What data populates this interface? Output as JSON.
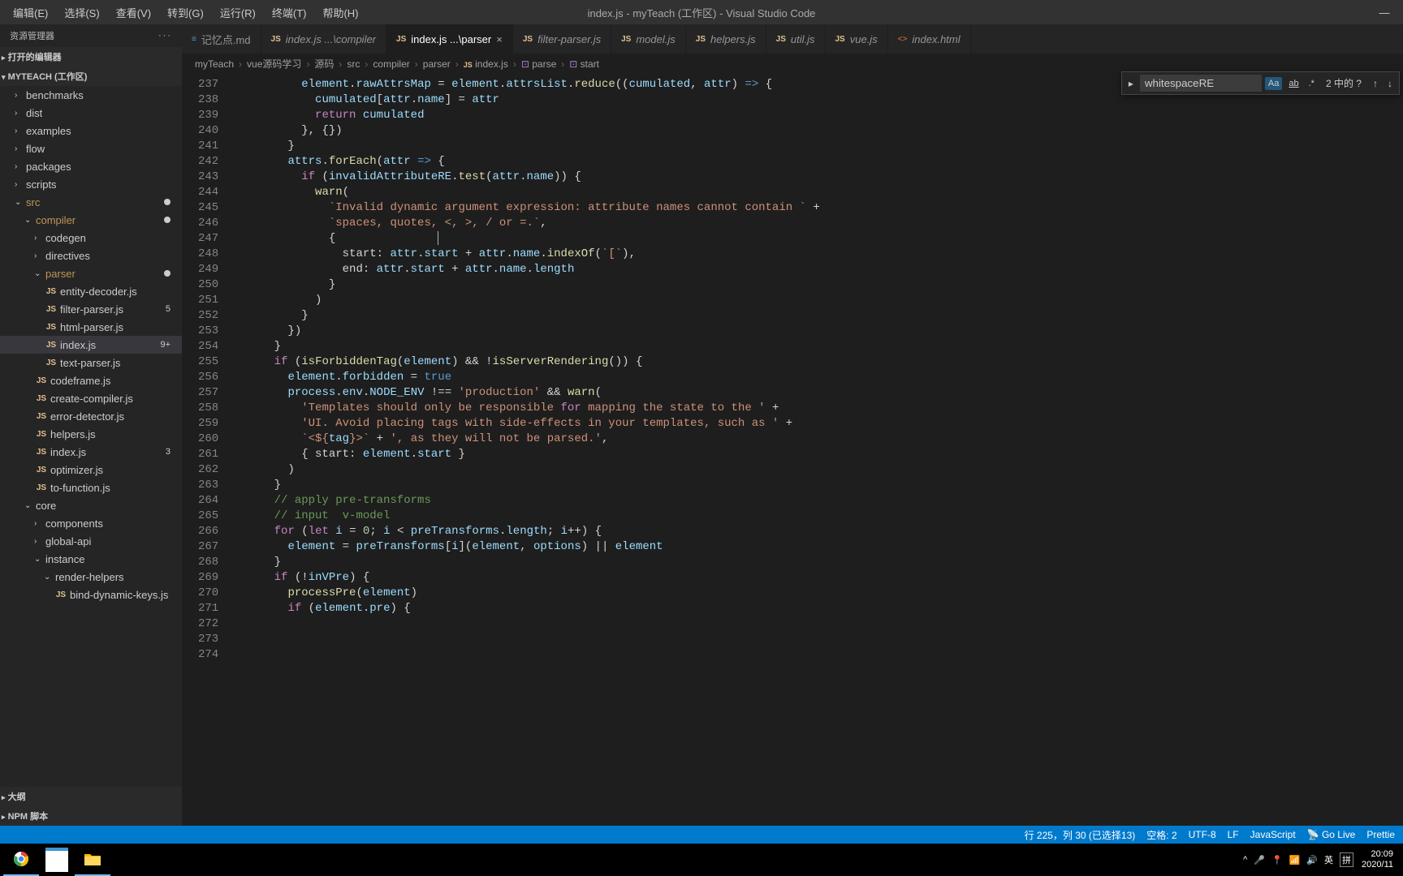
{
  "window": {
    "title": "index.js - myTeach (工作区) - Visual Studio Code"
  },
  "menubar": [
    "编辑(E)",
    "选择(S)",
    "查看(V)",
    "转到(G)",
    "运行(R)",
    "终端(T)",
    "帮助(H)"
  ],
  "sidebar": {
    "header": "资源管理器",
    "section_open": "打开的编辑器",
    "workspace": "MYTEACH (工作区)",
    "tree": [
      {
        "type": "folder",
        "label": "benchmarks",
        "depth": 1,
        "open": false
      },
      {
        "type": "folder",
        "label": "dist",
        "depth": 1,
        "open": false
      },
      {
        "type": "folder",
        "label": "examples",
        "depth": 1,
        "open": false
      },
      {
        "type": "folder",
        "label": "flow",
        "depth": 1,
        "open": false
      },
      {
        "type": "folder",
        "label": "packages",
        "depth": 1,
        "open": false
      },
      {
        "type": "folder",
        "label": "scripts",
        "depth": 1,
        "open": false
      },
      {
        "type": "folder",
        "label": "src",
        "depth": 1,
        "open": true,
        "dot": true,
        "color": "orange"
      },
      {
        "type": "folder",
        "label": "compiler",
        "depth": 2,
        "open": true,
        "dot": true,
        "color": "orange"
      },
      {
        "type": "folder",
        "label": "codegen",
        "depth": 3,
        "open": false
      },
      {
        "type": "folder",
        "label": "directives",
        "depth": 3,
        "open": false
      },
      {
        "type": "folder",
        "label": "parser",
        "depth": 3,
        "open": true,
        "dot": true,
        "color": "orange"
      },
      {
        "type": "file",
        "label": "entity-decoder.js",
        "depth": 4,
        "icon": "JS"
      },
      {
        "type": "file",
        "label": "filter-parser.js",
        "depth": 4,
        "icon": "JS",
        "badge": "5"
      },
      {
        "type": "file",
        "label": "html-parser.js",
        "depth": 4,
        "icon": "JS"
      },
      {
        "type": "file",
        "label": "index.js",
        "depth": 4,
        "icon": "JS",
        "badge": "9+",
        "active": true
      },
      {
        "type": "file",
        "label": "text-parser.js",
        "depth": 4,
        "icon": "JS"
      },
      {
        "type": "file",
        "label": "codeframe.js",
        "depth": 3,
        "icon": "JS"
      },
      {
        "type": "file",
        "label": "create-compiler.js",
        "depth": 3,
        "icon": "JS"
      },
      {
        "type": "file",
        "label": "error-detector.js",
        "depth": 3,
        "icon": "JS"
      },
      {
        "type": "file",
        "label": "helpers.js",
        "depth": 3,
        "icon": "JS"
      },
      {
        "type": "file",
        "label": "index.js",
        "depth": 3,
        "icon": "JS",
        "badge": "3"
      },
      {
        "type": "file",
        "label": "optimizer.js",
        "depth": 3,
        "icon": "JS"
      },
      {
        "type": "file",
        "label": "to-function.js",
        "depth": 3,
        "icon": "JS"
      },
      {
        "type": "folder",
        "label": "core",
        "depth": 2,
        "open": true
      },
      {
        "type": "folder",
        "label": "components",
        "depth": 3,
        "open": false
      },
      {
        "type": "folder",
        "label": "global-api",
        "depth": 3,
        "open": false
      },
      {
        "type": "folder",
        "label": "instance",
        "depth": 3,
        "open": true
      },
      {
        "type": "folder",
        "label": "render-helpers",
        "depth": 4,
        "open": true
      },
      {
        "type": "file",
        "label": "bind-dynamic-keys.js",
        "depth": 5,
        "icon": "JS"
      }
    ],
    "footer1": "大纲",
    "footer2": "NPM 脚本"
  },
  "tabs": [
    {
      "icon": "≡",
      "label": "记忆点.md",
      "italic": false
    },
    {
      "icon": "JS",
      "label": "index.js ...\\compiler",
      "italic": true
    },
    {
      "icon": "JS",
      "label": "index.js ...\\parser",
      "active": true,
      "close": true
    },
    {
      "icon": "JS",
      "label": "filter-parser.js",
      "italic": true
    },
    {
      "icon": "JS",
      "label": "model.js",
      "italic": true
    },
    {
      "icon": "JS",
      "label": "helpers.js",
      "italic": true
    },
    {
      "icon": "JS",
      "label": "util.js",
      "italic": true
    },
    {
      "icon": "JS",
      "label": "vue.js",
      "italic": true
    },
    {
      "icon": "<>",
      "label": "index.html",
      "italic": true
    }
  ],
  "breadcrumb": [
    "myTeach",
    "vue源码学习",
    "源码",
    "src",
    "compiler",
    "parser",
    "index.js",
    "parse",
    "start"
  ],
  "find": {
    "value": "whitespaceRE",
    "result": "2 中的 ?"
  },
  "code": {
    "start": 237,
    "lines": [
      "          element.rawAttrsMap = element.attrsList.reduce((cumulated, attr) => {",
      "            cumulated[attr.name] = attr",
      "            return cumulated",
      "          }, {})",
      "        }",
      "        attrs.forEach(attr => {",
      "          if (invalidAttributeRE.test(attr.name)) {",
      "            warn(",
      "              `Invalid dynamic argument expression: attribute names cannot contain ` +",
      "              `spaces, quotes, <, >, / or =.`,",
      "              {",
      "                start: attr.start + attr.name.indexOf(`[`),",
      "                end: attr.start + attr.name.length",
      "              }",
      "            )",
      "          }",
      "        })",
      "      }",
      "",
      "      if (isForbiddenTag(element) && !isServerRendering()) {",
      "        element.forbidden = true",
      "        process.env.NODE_ENV !== 'production' && warn(",
      "          'Templates should only be responsible for mapping the state to the ' +",
      "          'UI. Avoid placing tags with side-effects in your templates, such as ' +",
      "          `<${tag}>` + ', as they will not be parsed.',",
      "          { start: element.start }",
      "        )",
      "      }",
      "",
      "      // apply pre-transforms",
      "      // input  v-model",
      "      for (let i = 0; i < preTransforms.length; i++) {",
      "        element = preTransforms[i](element, options) || element",
      "      }",
      "",
      "      if (!inVPre) {",
      "        processPre(element)",
      "        if (element.pre) {"
    ]
  },
  "statusbar": {
    "pos": "行 225，列 30 (已选择13)",
    "spaces": "空格: 2",
    "enc": "UTF-8",
    "eol": "LF",
    "lang": "JavaScript",
    "golive": "Go Live",
    "prettier": "Prettie"
  },
  "taskbar": {
    "time": "20:09",
    "date": "2020/11",
    "ime1": "英",
    "ime2": "拼"
  }
}
